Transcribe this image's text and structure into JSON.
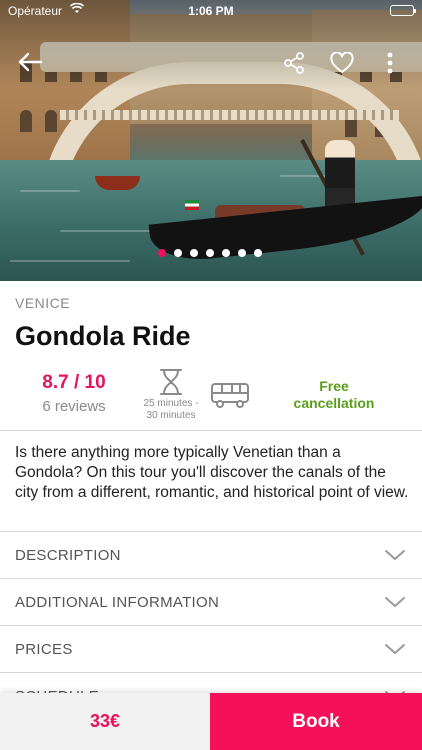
{
  "status_bar": {
    "carrier": "Opérateur",
    "time": "1:06 PM",
    "wifi_icon": "wifi-icon",
    "battery_icon": "battery-icon"
  },
  "header": {
    "back_icon": "arrow-left-icon",
    "share_icon": "share-icon",
    "favorite_icon": "heart-icon",
    "more_icon": "more-vertical-icon"
  },
  "gallery": {
    "total_images": 7,
    "active_index": 0
  },
  "tour": {
    "city": "VENICE",
    "title": "Gondola Ride",
    "rating": "8.7 / 10",
    "reviews": "6 reviews",
    "duration": "25 minutes - 30 minutes",
    "transport_icon": "bus-icon",
    "duration_icon": "hourglass-icon",
    "cancellation": "Free cancellation",
    "description": "Is there anything more typically Venetian than a Gondola? On this tour you'll discover the canals of the city from a different, romantic, and historical point of view."
  },
  "sections": [
    {
      "label": "DESCRIPTION"
    },
    {
      "label": "ADDITIONAL INFORMATION"
    },
    {
      "label": "PRICES"
    },
    {
      "label": "SCHEDULE"
    }
  ],
  "footer": {
    "price": "33€",
    "book_label": "Book"
  },
  "colors": {
    "accent": "#e8135a",
    "book_bg": "#f5105a",
    "cancel_green": "#5a9e1a"
  }
}
